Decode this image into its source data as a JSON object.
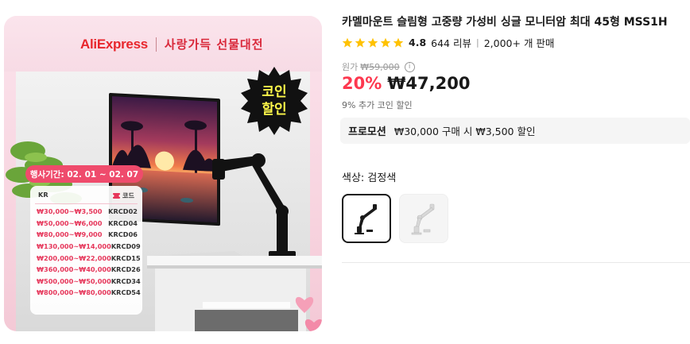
{
  "banner": {
    "brand_logo": "AliExpress",
    "campaign_text": "사랑가득 선물대전",
    "badge_line1": "코인",
    "badge_line2": "할인",
    "period": "행사기간: 02. 01 ~ 02. 07",
    "table_header_left": "KR",
    "table_header_right": "코드",
    "codes": [
      {
        "range": "₩30,000~₩3,500",
        "code": "KRCD02"
      },
      {
        "range": "₩50,000~₩6,000",
        "code": "KRCD04"
      },
      {
        "range": "₩80,000~₩9,000",
        "code": "KRCD06"
      },
      {
        "range": "₩130,000~₩14,000",
        "code": "KRCD09"
      },
      {
        "range": "₩200,000~₩22,000",
        "code": "KRCD15"
      },
      {
        "range": "₩360,000~₩40,000",
        "code": "KRCD26"
      },
      {
        "range": "₩500,000~₩50,000",
        "code": "KRCD34"
      },
      {
        "range": "₩800,000~₩80,000",
        "code": "KRCD54"
      }
    ]
  },
  "product": {
    "title": "카멜마운트 슬림형 고중량 가성비 싱글 모니터암 최대 45형 MSS1H",
    "rating": "4.8",
    "reviews": "644 리뷰",
    "sold": "2,000+ 개 판매",
    "original_label": "원가",
    "original_price": "₩59,000",
    "discount": "20%",
    "price": "₩47,200",
    "coin_note": "9% 추가 코인 할인",
    "promo_label": "프로모션",
    "promo_text": "₩30,000 구매 시 ₩3,500 할인",
    "color_label": "색상: 검정색",
    "swatches": [
      {
        "name": "black-arm",
        "selected": true
      },
      {
        "name": "white-arm",
        "selected": false
      }
    ]
  },
  "colors": {
    "price_red": "#fd384f",
    "star_yellow": "#ffc200",
    "banner_pink": "#f8d6e1",
    "code_pink": "#e6365a"
  }
}
